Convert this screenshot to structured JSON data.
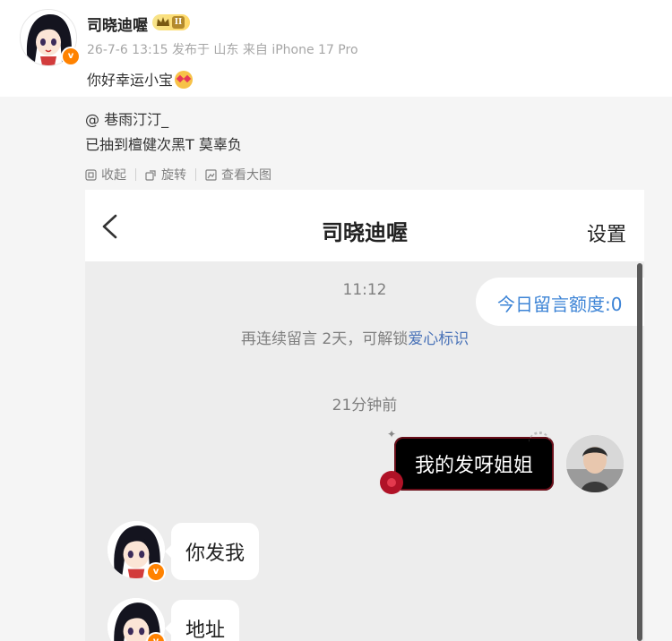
{
  "post": {
    "author": "司晓迪喔",
    "member_level": "II",
    "meta": "26-7-6 13:15  发布于 山东  来自 iPhone 17 Pro",
    "text": "你好幸运小宝"
  },
  "retweet": {
    "user": "@ 巷雨汀汀_",
    "text": "已抽到檀健次黑T 莫辜负",
    "actions": {
      "collect": "收起",
      "rotate": "旋转",
      "view_large": "查看大图"
    }
  },
  "screenshot": {
    "title": "司晓迪喔",
    "settings": "设置",
    "time1": "11:12",
    "unlock_prefix": "再连续留言 2天，可解锁",
    "unlock_link": "爱心标识",
    "quota": "今日留言额度:0",
    "time2": "21分钟前",
    "my_message": "我的发呀姐姐",
    "their_messages": [
      "你发我",
      "地址"
    ]
  },
  "colors": {
    "accent_blue": "#3d84d6",
    "link_blue": "#4a73b8",
    "verified_orange": "#ff8200"
  },
  "icons": [
    "crown-badge-icon",
    "collect-icon",
    "rotate-icon",
    "view-large-icon",
    "back-arrow-icon",
    "verified-icon"
  ]
}
